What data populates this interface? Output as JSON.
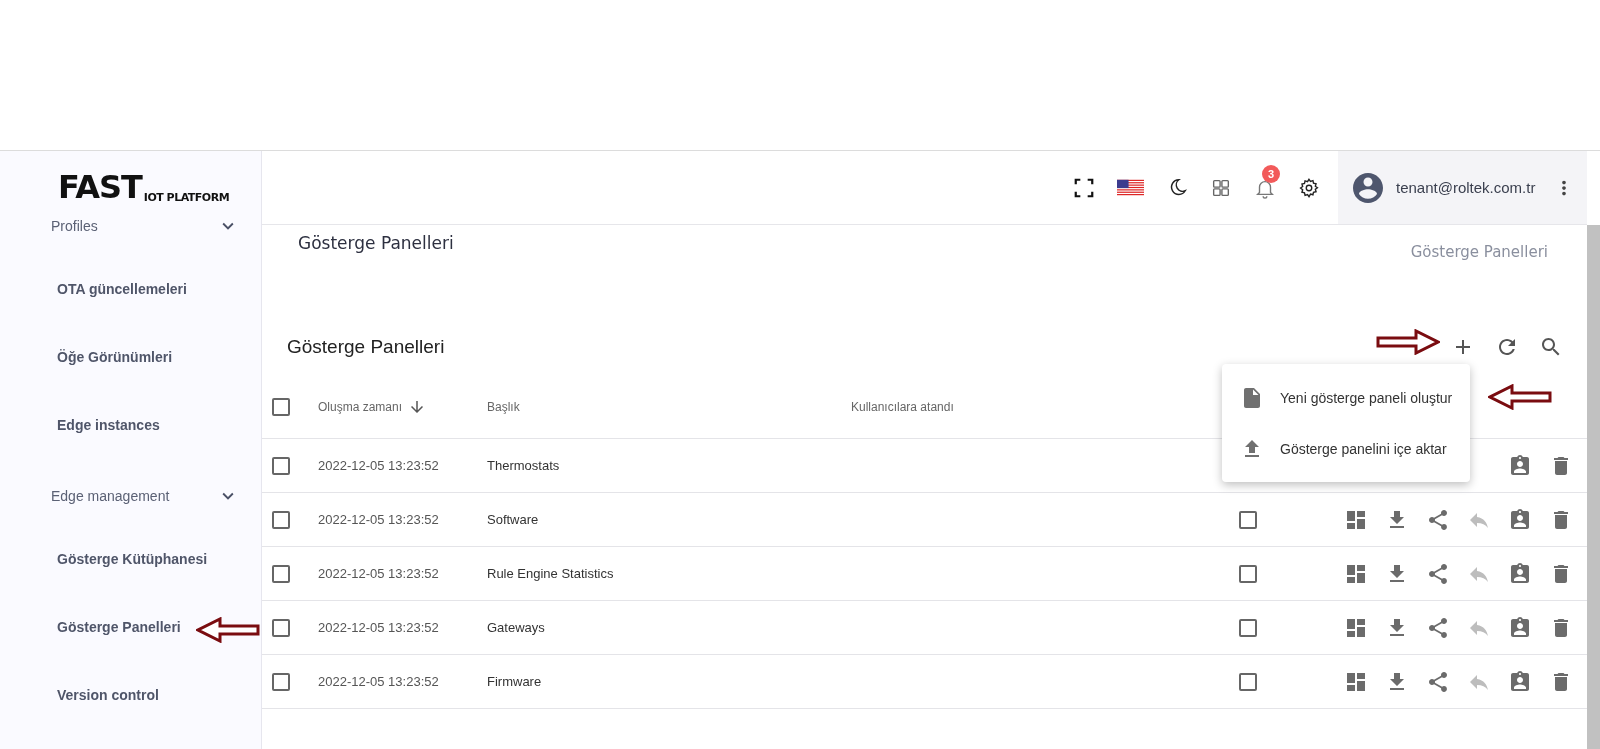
{
  "logo": {
    "main": "FAST",
    "sub": "IOT PLATFORM"
  },
  "sidebar": {
    "items": [
      {
        "kind": "group",
        "label": "Profiles",
        "expanded": true
      },
      {
        "kind": "item",
        "label": "OTA güncellemeleri"
      },
      {
        "kind": "item",
        "label": "Öğe Görünümleri"
      },
      {
        "kind": "item",
        "label": "Edge instances"
      },
      {
        "kind": "group",
        "label": "Edge management",
        "expanded": true
      },
      {
        "kind": "item",
        "label": "Gösterge Kütüphanesi"
      },
      {
        "kind": "item",
        "label": "Gösterge Panelleri"
      },
      {
        "kind": "item",
        "label": "Version control"
      }
    ]
  },
  "header": {
    "notification_count": "3",
    "user_email": "tenant@roltek.com.tr"
  },
  "page_title": "Gösterge Panelleri",
  "breadcrumb": "Gösterge Panelleri",
  "table": {
    "title": "Gösterge Panelleri",
    "select_all_checked": false,
    "columns": [
      {
        "label": "Oluşma zamanı",
        "sorted_descending": true
      },
      {
        "label": "Başlık"
      },
      {
        "label": "Kullanıcılara atandı"
      }
    ],
    "rows": [
      {
        "checked": false,
        "created": "2022-12-05 13:23:52",
        "title": "Thermostats",
        "actions": [
          {
            "kind": "assign",
            "disabled": false
          },
          {
            "kind": "delete",
            "disabled": false
          }
        ]
      },
      {
        "checked": false,
        "created": "2022-12-05 13:23:52",
        "title": "Software",
        "public_checked": false,
        "actions": [
          {
            "kind": "open",
            "disabled": false
          },
          {
            "kind": "export",
            "disabled": false
          },
          {
            "kind": "share",
            "disabled": false
          },
          {
            "kind": "unshare",
            "disabled": true
          },
          {
            "kind": "assign",
            "disabled": false
          },
          {
            "kind": "delete",
            "disabled": false
          }
        ]
      },
      {
        "checked": false,
        "created": "2022-12-05 13:23:52",
        "title": "Rule Engine Statistics",
        "public_checked": false,
        "actions": [
          {
            "kind": "open",
            "disabled": false
          },
          {
            "kind": "export",
            "disabled": false
          },
          {
            "kind": "share",
            "disabled": false
          },
          {
            "kind": "unshare",
            "disabled": true
          },
          {
            "kind": "assign",
            "disabled": false
          },
          {
            "kind": "delete",
            "disabled": false
          }
        ]
      },
      {
        "checked": false,
        "created": "2022-12-05 13:23:52",
        "title": "Gateways",
        "public_checked": false,
        "actions": [
          {
            "kind": "open",
            "disabled": false
          },
          {
            "kind": "export",
            "disabled": false
          },
          {
            "kind": "share",
            "disabled": false
          },
          {
            "kind": "unshare",
            "disabled": true
          },
          {
            "kind": "assign",
            "disabled": false
          },
          {
            "kind": "delete",
            "disabled": false
          }
        ]
      },
      {
        "checked": false,
        "created": "2022-12-05 13:23:52",
        "title": "Firmware",
        "public_checked": false,
        "actions": [
          {
            "kind": "open",
            "disabled": false
          },
          {
            "kind": "export",
            "disabled": false
          },
          {
            "kind": "share",
            "disabled": false
          },
          {
            "kind": "unshare",
            "disabled": true
          },
          {
            "kind": "assign",
            "disabled": false
          },
          {
            "kind": "delete",
            "disabled": false
          }
        ]
      }
    ]
  },
  "add_menu": {
    "items": [
      {
        "kind": "create",
        "label": "Yeni gösterge paneli oluştur"
      },
      {
        "kind": "import",
        "label": "Gösterge panelini içe aktar"
      }
    ]
  },
  "annotation_arrows": [
    {
      "points_left": false
    },
    {
      "points_left": true
    },
    {
      "points_left": true
    }
  ]
}
